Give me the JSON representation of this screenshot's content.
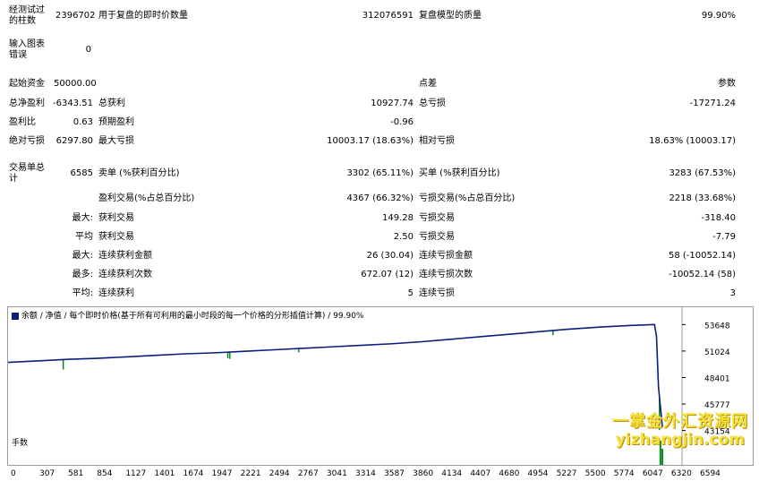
{
  "stats": {
    "bars": {
      "label": "经测试过\n的柱数",
      "value": "2396702"
    },
    "ticks": {
      "label": "用于复盘的即时价数量",
      "value": "312076591"
    },
    "quality": {
      "label": "复盘模型的质量",
      "value": "99.90%"
    },
    "errors": {
      "label": "输入图表\n错误",
      "value": "0"
    },
    "initial_deposit": {
      "label": "起始资金",
      "value": "50000.00"
    },
    "spread": {
      "label": "点差",
      "value": "参数"
    },
    "net_profit": {
      "label": "总净盈利",
      "value": "-6343.51"
    },
    "gross_profit": {
      "label": "总获利",
      "value": "10927.74"
    },
    "gross_loss": {
      "label": "总亏损",
      "value": "-17271.24"
    },
    "profit_factor": {
      "label": "盈利比",
      "value": "0.63"
    },
    "expected_payoff": {
      "label": "预期盈利",
      "value": "-0.96"
    },
    "abs_drawdown": {
      "label": "绝对亏损",
      "value": "6297.80"
    },
    "max_drawdown": {
      "label": "最大亏损",
      "value": "10003.17 (18.63%)"
    },
    "rel_drawdown": {
      "label": "相对亏损",
      "value": "18.63% (10003.17)"
    },
    "total_trades": {
      "label": "交易单总\n计",
      "value": "6585"
    },
    "short_positions": {
      "label": "卖单 (%获利百分比)",
      "value": "3302 (65.11%)"
    },
    "long_positions": {
      "label": "买单 (%获利百分比)",
      "value": "3283 (67.53%)"
    },
    "profit_trades": {
      "label": "盈利交易(%占总百分比)",
      "value": "4367 (66.32%)"
    },
    "loss_trades": {
      "label": "亏损交易(%占总百分比)",
      "value": "2218 (33.68%)"
    },
    "largest_profit": {
      "prefix": "最大:",
      "label": "获利交易",
      "value": "149.28"
    },
    "largest_loss": {
      "label": "亏损交易",
      "value": "-318.40"
    },
    "average_profit": {
      "prefix": "平均",
      "label": "获利交易",
      "value": "2.50"
    },
    "average_loss": {
      "label": "亏损交易",
      "value": "-7.79"
    },
    "max_consec_wins": {
      "prefix": "最大:",
      "label": "连续获利金额",
      "value": "26 (30.04)"
    },
    "max_consec_losses": {
      "label": "连续亏损金额",
      "value": "58 (-10052.14)"
    },
    "max_consec_profit": {
      "prefix": "最多:",
      "label": "连续获利次数",
      "value": "672.07 (12)"
    },
    "max_consec_loss": {
      "label": "连续亏损次数",
      "value": "-10052.14 (58)"
    },
    "avg_consec_wins": {
      "prefix": "平均:",
      "label": "连续获利",
      "value": "5"
    },
    "avg_consec_losses": {
      "label": "连续亏损",
      "value": "3"
    }
  },
  "chart_data": {
    "type": "line",
    "title": "余额 / 净值 / 每个即时价格(基于所有可利用的最小时段的每一个价格的分形插值计算) / 99.90%",
    "legend": [
      "余额",
      "净值"
    ],
    "colors": {
      "balance": "#0a1e7a",
      "equity": "#0a8a1e",
      "volume": "#0a8a1e"
    },
    "x_ticks": [
      "0",
      "307",
      "581",
      "854",
      "1127",
      "1401",
      "1674",
      "1947",
      "2221",
      "2494",
      "2767",
      "3041",
      "3314",
      "3587",
      "3860",
      "4134",
      "4407",
      "4680",
      "4954",
      "5227",
      "5500",
      "5774",
      "6047",
      "6320",
      "6594"
    ],
    "y_ticks": [
      "53648",
      "51024",
      "48401",
      "45777",
      "43154"
    ],
    "ylim": [
      42500,
      54300
    ],
    "xlim": [
      0,
      6830
    ],
    "balance": {
      "x": [
        0,
        300,
        600,
        900,
        1200,
        1500,
        1800,
        2100,
        2400,
        2700,
        3000,
        3300,
        3600,
        3900,
        4200,
        4500,
        4800,
        5100,
        5400,
        5700,
        6000,
        6300,
        6560,
        6580,
        6600,
        6640
      ],
      "y": [
        49900,
        50050,
        50200,
        50300,
        50450,
        50600,
        50750,
        50850,
        51000,
        51150,
        51300,
        51450,
        51600,
        51750,
        51950,
        52200,
        52450,
        52700,
        52950,
        53200,
        53400,
        53550,
        53650,
        52500,
        47500,
        43500
      ]
    },
    "equity_dips": [
      {
        "x": 560,
        "y": 49200
      },
      {
        "x": 2230,
        "y": 50300
      },
      {
        "x": 2250,
        "y": 50250
      },
      {
        "x": 2950,
        "y": 50900
      },
      {
        "x": 5530,
        "y": 52600
      },
      {
        "x": 6610,
        "y": 43200
      }
    ],
    "volume_label": "手数",
    "volume_spikes": [
      {
        "x": 6620,
        "level": 0.9
      },
      {
        "x": 6640,
        "level": 0.6
      }
    ]
  },
  "watermark": {
    "line1": "一掌金外汇资源网",
    "line2": "yizhangjin.com"
  }
}
